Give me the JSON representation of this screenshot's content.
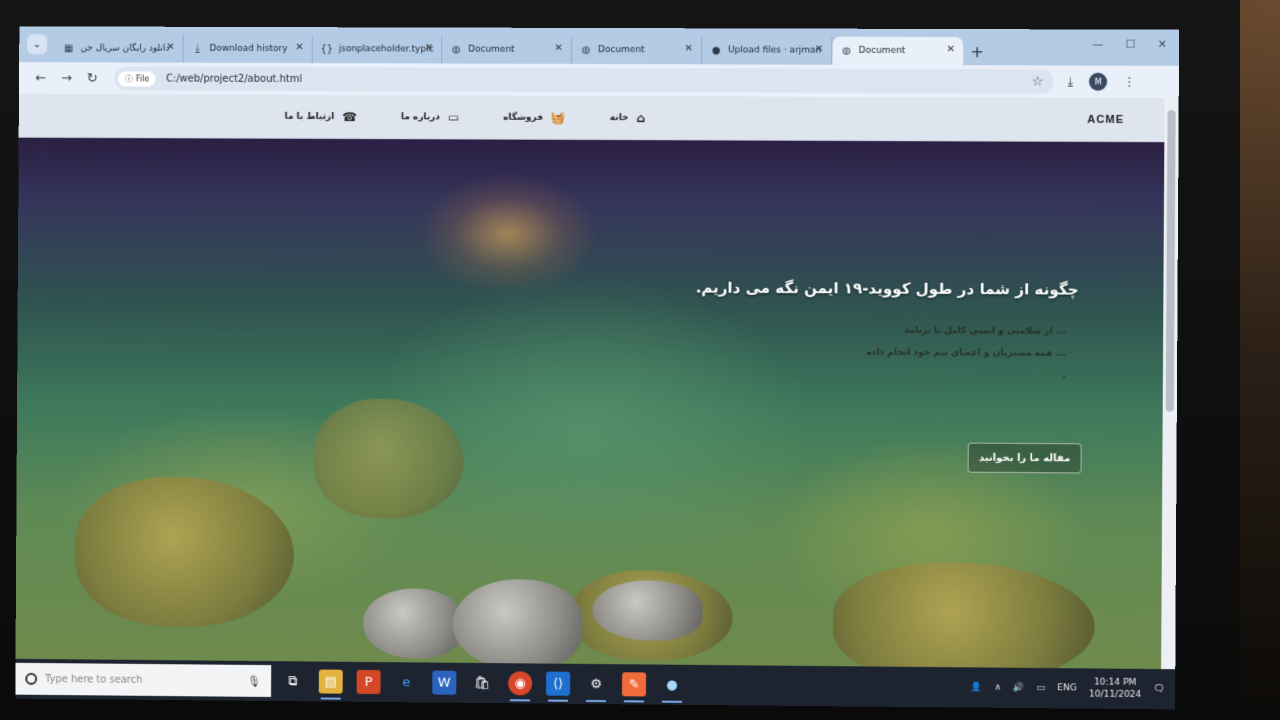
{
  "browser": {
    "tabs": [
      {
        "title": "دانلود رایگان سریال جن",
        "icon": "site-icon",
        "active": false
      },
      {
        "title": "Download history",
        "icon": "download-icon",
        "active": false
      },
      {
        "title": "jsonplaceholder.typic",
        "icon": "code-icon",
        "active": false
      },
      {
        "title": "Document",
        "icon": "globe-icon",
        "active": false
      },
      {
        "title": "Document",
        "icon": "globe-icon",
        "active": false
      },
      {
        "title": "Upload files · arjman",
        "icon": "github-icon",
        "active": false
      },
      {
        "title": "Document",
        "icon": "globe-icon",
        "active": true
      }
    ],
    "file_chip": "File",
    "url": "C:/web/project2/about.html",
    "profile_initial": "M"
  },
  "site": {
    "brand": "ACME",
    "menu": [
      {
        "label": "خانه",
        "icon": "home-icon"
      },
      {
        "label": "فروشگاه",
        "icon": "basket-icon"
      },
      {
        "label": "درباره ما",
        "icon": "id-card-icon"
      },
      {
        "label": "ارتباط با ما",
        "icon": "phone-icon"
      }
    ],
    "hero_title": "چگونه از شما در طول کووید-۱۹ ایمن نگه می داریم.",
    "hero_lines": [
      "... از سلامتی و ایمنی کامل با برنامه",
      "... همه مشتریان و اعضای تیم خود انجام داده",
      "."
    ],
    "cta_label": "مقاله ما را بخوانید"
  },
  "taskbar": {
    "search_placeholder": "Type here to search",
    "language": "ENG",
    "time": "10:14 PM",
    "date": "10/11/2024"
  }
}
